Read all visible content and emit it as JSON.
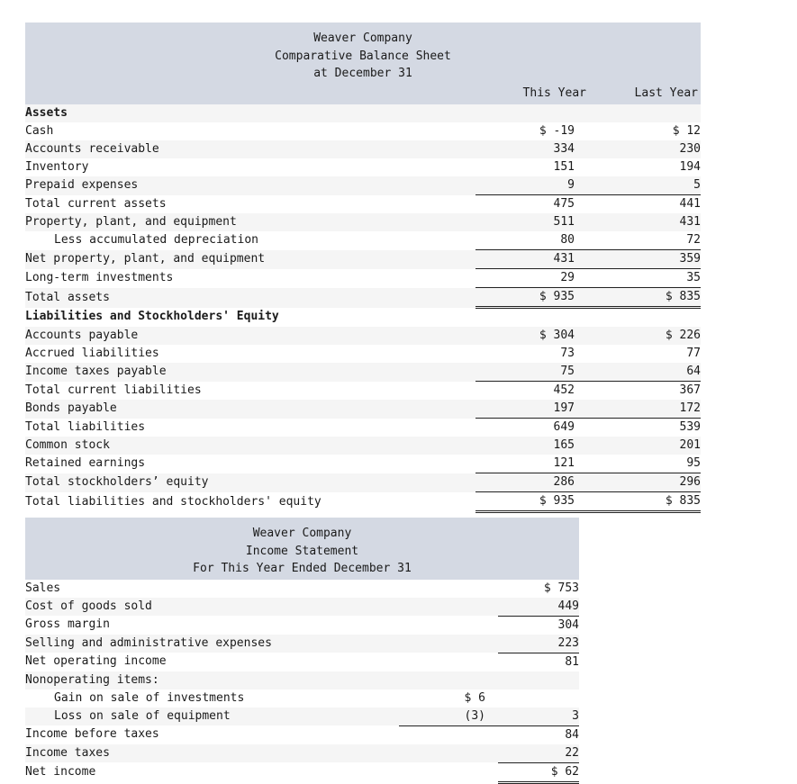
{
  "balance_sheet": {
    "title_lines": [
      "Weaver Company",
      "Comparative Balance Sheet",
      "at December 31"
    ],
    "columns": [
      "This Year",
      "Last Year"
    ],
    "rows": [
      {
        "label": "Assets",
        "bold": true,
        "this": "",
        "last": ""
      },
      {
        "label": "Cash",
        "this": "$ -19",
        "last": "$ 12"
      },
      {
        "label": "Accounts receivable",
        "this": "334",
        "last": "230"
      },
      {
        "label": "Inventory",
        "this": "151",
        "last": "194"
      },
      {
        "label": "Prepaid expenses",
        "this": "9",
        "last": "5"
      },
      {
        "label": "Total current assets",
        "this": "475",
        "last": "441",
        "rule": "top"
      },
      {
        "label": "Property, plant, and equipment",
        "this": "511",
        "last": "431"
      },
      {
        "label": "Less accumulated depreciation",
        "this": "80",
        "last": "72",
        "indent": true
      },
      {
        "label": "Net property, plant, and equipment",
        "this": "431",
        "last": "359",
        "rule": "top"
      },
      {
        "label": "Long-term investments",
        "this": "29",
        "last": "35",
        "rule": "top"
      },
      {
        "label": "Total assets",
        "this": "$ 935",
        "last": "$ 835",
        "rule": "top",
        "rule_bottom": "double"
      },
      {
        "label": "Liabilities and Stockholders' Equity",
        "bold": true,
        "this": "",
        "last": ""
      },
      {
        "label": "Accounts payable",
        "this": "$ 304",
        "last": "$ 226"
      },
      {
        "label": "Accrued liabilities",
        "this": "73",
        "last": "77"
      },
      {
        "label": "Income taxes payable",
        "this": "75",
        "last": "64"
      },
      {
        "label": "Total current liabilities",
        "this": "452",
        "last": "367",
        "rule": "top"
      },
      {
        "label": "Bonds payable",
        "this": "197",
        "last": "172"
      },
      {
        "label": "Total liabilities",
        "this": "649",
        "last": "539",
        "rule": "top"
      },
      {
        "label": "Common stock",
        "this": "165",
        "last": "201"
      },
      {
        "label": "Retained earnings",
        "this": "121",
        "last": "95"
      },
      {
        "label": "Total stockholders’ equity",
        "this": "286",
        "last": "296",
        "rule": "top"
      },
      {
        "label": "Total liabilities and stockholders' equity",
        "this": "$ 935",
        "last": "$ 835",
        "rule": "top",
        "rule_bottom": "double"
      }
    ]
  },
  "income_statement": {
    "title_lines": [
      "Weaver Company",
      "Income Statement",
      "For This Year Ended December 31"
    ],
    "rows": [
      {
        "label": "Sales",
        "inner": "",
        "outer": "$ 753"
      },
      {
        "label": "Cost of goods sold",
        "inner": "",
        "outer": "449"
      },
      {
        "label": "Gross margin",
        "inner": "",
        "outer": "304",
        "rule": "top-outer"
      },
      {
        "label": "Selling and administrative expenses",
        "inner": "",
        "outer": "223"
      },
      {
        "label": "Net operating income",
        "inner": "",
        "outer": "81",
        "rule": "top-outer"
      },
      {
        "label": "Nonoperating items:",
        "inner": "",
        "outer": ""
      },
      {
        "label": "Gain on sale of investments",
        "inner": "$ 6",
        "outer": "",
        "indent": true
      },
      {
        "label": "Loss on sale of equipment",
        "inner": "(3)",
        "outer": "3",
        "indent": true
      },
      {
        "label": "Income before taxes",
        "inner": "",
        "outer": "84",
        "rule": "top-inner-outer"
      },
      {
        "label": "Income taxes",
        "inner": "",
        "outer": "22"
      },
      {
        "label": "Net income",
        "inner": "",
        "outer": "$ 62",
        "rule": "top-outer",
        "rule_bottom": "single"
      }
    ]
  }
}
